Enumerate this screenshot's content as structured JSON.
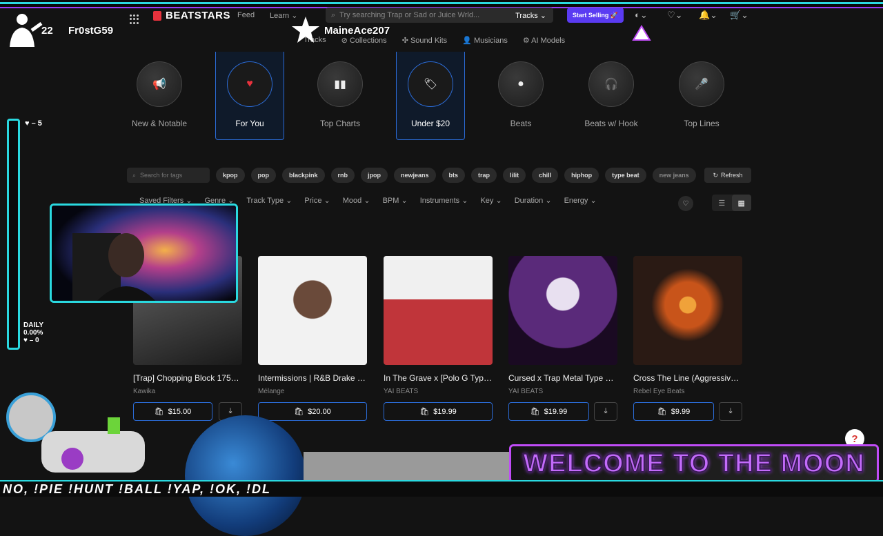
{
  "nav": {
    "logo": "BEATSTARS",
    "feed": "Feed",
    "learn": "Learn",
    "search_placeholder": "Try searching Trap or Sad or Juice Wrld...",
    "search_scope": "Tracks",
    "start_selling": "Start Selling"
  },
  "subnav": [
    "Tracks",
    "Collections",
    "Sound Kits",
    "Musicians",
    "AI Models"
  ],
  "categories": [
    {
      "label": "New & Notable",
      "icon": "📢"
    },
    {
      "label": "For You",
      "icon": "♥"
    },
    {
      "label": "Top Charts",
      "icon": "▮▮"
    },
    {
      "label": "Under $20",
      "icon": "🏷"
    },
    {
      "label": "Beats",
      "icon": "●"
    },
    {
      "label": "Beats w/ Hook",
      "icon": "🎧"
    },
    {
      "label": "Top Lines",
      "icon": "🎤"
    }
  ],
  "tag_search_placeholder": "Search for tags",
  "tags": [
    "kpop",
    "pop",
    "blackpink",
    "rnb",
    "jpop",
    "newjeans",
    "bts",
    "trap",
    "lilit",
    "chill",
    "hiphop",
    "type beat",
    "new jeans"
  ],
  "refresh": "Refresh",
  "filters": [
    "Saved Filters",
    "Genre",
    "Track Type",
    "Price",
    "Mood",
    "BPM",
    "Instruments",
    "Key",
    "Duration",
    "Energy"
  ],
  "tracks": [
    {
      "title": "[Trap] Chopping Block 175b...",
      "artist": "Kawika",
      "price": "$15.00",
      "colors": [
        "#555",
        "#222"
      ]
    },
    {
      "title": "Intermissions | R&B Drake x ...",
      "artist": "Mélange",
      "price": "$20.00",
      "colors": [
        "#eee",
        "#777"
      ]
    },
    {
      "title": "In The Grave x [Polo G Type ...",
      "artist": "YAI BEATS",
      "price": "$19.99",
      "colors": [
        "#e9e9e9",
        "#c0353a"
      ]
    },
    {
      "title": "Cursed x Trap Metal Type B...",
      "artist": "YAI BEATS",
      "price": "$19.99",
      "colors": [
        "#5a2a7a",
        "#1a0a22"
      ]
    },
    {
      "title": "Cross The Line (Aggressive ...",
      "artist": "Rebel Eye Beats",
      "price": "$9.99",
      "colors": [
        "#d86a1c",
        "#2a1a14"
      ]
    }
  ],
  "overlay": {
    "num": "22",
    "user1": "Fr0stG59",
    "user2": "MaineAce207",
    "side_top": "♥ – 5",
    "daily": "DAILY",
    "daily_pct": "0.00%",
    "side_bottom": "♥ – 0",
    "banner": "WELCOME TO THE MOON",
    "ticker": "NO, !PIE !HUNT !BALL !YAP, !OK, !DL",
    "help": "?",
    "progress": 0
  }
}
